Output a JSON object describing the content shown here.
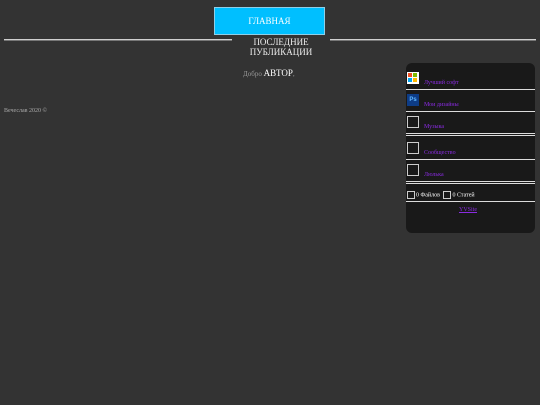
{
  "nav": {
    "home_label": "ГЛАВНАЯ"
  },
  "section": {
    "recent_publications": "ПОСЛЕДНИЕ ПУБЛИКАЦИИ"
  },
  "welcome": {
    "prefix": "Добро",
    "author": "АВТОР",
    "suffix": ","
  },
  "footer": {
    "copyright": "Вечеслав 2020 ©"
  },
  "sidebar": {
    "items": [
      {
        "label": "Лучший софт",
        "icon": "windows-icon"
      },
      {
        "label": "Мои дизайны",
        "icon": "photoshop-icon"
      },
      {
        "label": "Музыка",
        "icon": "broken-image-icon"
      },
      {
        "label": "Сообщество",
        "icon": "broken-image-icon"
      },
      {
        "label": "Люлька",
        "icon": "broken-image-icon"
      }
    ],
    "stats": {
      "files": "0 Файлов",
      "articles": "0 Статей"
    },
    "link": "YVSite",
    "accent_color": "#8a2be2"
  },
  "colors": {
    "background": "#333333",
    "panel": "#191919",
    "button": "#00bfff"
  }
}
